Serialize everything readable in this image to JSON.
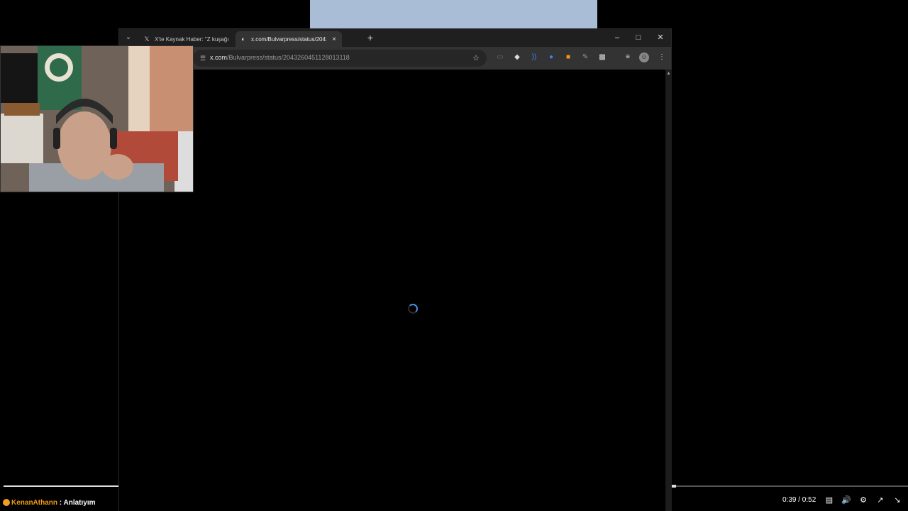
{
  "browser": {
    "tabs": [
      {
        "title": "X'te Kaynak Haber: \"Z kuşağı, s",
        "favicon": "x-logo-icon",
        "active": false
      },
      {
        "title": "x.com/Bulvarpress/status/2043",
        "favicon": "loading-globe-icon",
        "active": true
      }
    ],
    "new_tab_label": "+",
    "address": {
      "host": "x.com",
      "path": "/Bulvarpress/status/2043260451128013118"
    }
  },
  "stream": {
    "time": "0:39 / 0:52",
    "chat": {
      "user": "KenanAthann",
      "separator": " : ",
      "message": "Anlatıyım"
    }
  },
  "colors": {
    "accent_blue": "#4a90d9",
    "username_orange": "#f39c12",
    "toolbar": "#333333",
    "tabstrip": "#1f1f1f"
  }
}
